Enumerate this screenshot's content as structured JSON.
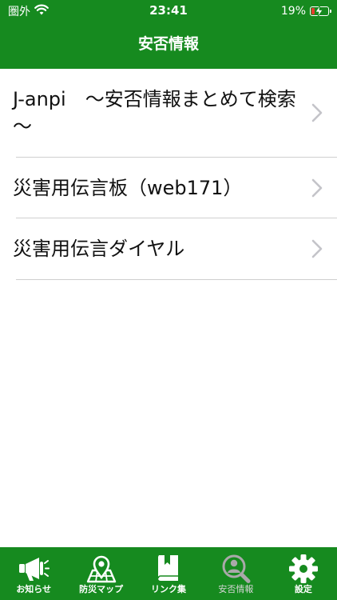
{
  "status_bar": {
    "carrier": "圏外",
    "time": "23:41",
    "battery": "19%",
    "battery_level": 0.19
  },
  "nav": {
    "title": "安否情報"
  },
  "list": {
    "items": [
      {
        "label": "J-anpi　～安否情報まとめて検索～"
      },
      {
        "label": "災害用伝言板（web171）"
      },
      {
        "label": "災害用伝言ダイヤル"
      }
    ]
  },
  "tabbar": {
    "tabs": [
      {
        "label": "お知らせ",
        "icon": "megaphone-icon"
      },
      {
        "label": "防災マップ",
        "icon": "map-pin-icon"
      },
      {
        "label": "リンク集",
        "icon": "book-icon"
      },
      {
        "label": "安否情報",
        "icon": "search-person-icon",
        "active": true
      },
      {
        "label": "設定",
        "icon": "gear-icon"
      }
    ]
  },
  "colors": {
    "brand_green": "#168a1f",
    "battery_low": "#e53b2f",
    "inactive_icon": "#a9a9a9"
  }
}
